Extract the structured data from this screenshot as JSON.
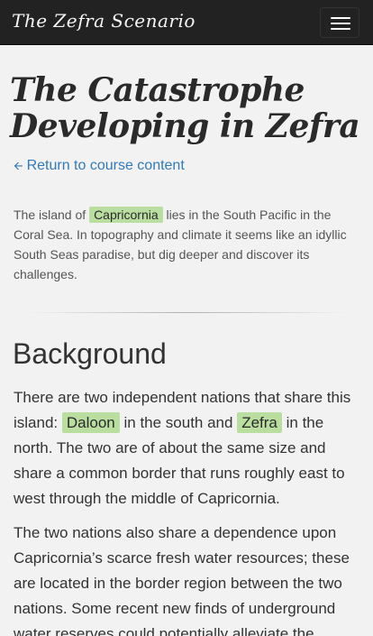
{
  "navbar": {
    "brand": "The Zefra Scenario",
    "toggle_icon": "hamburger-menu-icon"
  },
  "page": {
    "title": "The Catastrophe Developing in Zefra",
    "back_link": {
      "icon": "arrow-left-icon",
      "label": "Return to course content"
    }
  },
  "lead": {
    "before": "The island of",
    "highlight": "Capricornia",
    "after": "lies in the South Pacific in the Coral Sea. In topography and climate it seems like an idyllic South Seas paradise, but dig deeper and discover its challenges."
  },
  "background": {
    "heading": "Background",
    "p1": {
      "t1": "There are two independent nations that share this island:",
      "h1": "Daloon",
      "t2": "in the south and",
      "h2": "Zefra",
      "t3": "in the north. The two are of about the same size and share a common border that runs roughly east to west through the middle of Capricornia."
    },
    "p2": "The two nations also share a dependence upon Capricornia’s scarce fresh water resources; these are located in the border region between the two nations. Some recent new finds of underground water reserves could potentially alleviate the"
  },
  "colors": {
    "navbar_bg": "#222222",
    "highlight_bg": "#b9dea0",
    "link": "#337ab7",
    "page_bg": "#f2f2f2"
  }
}
